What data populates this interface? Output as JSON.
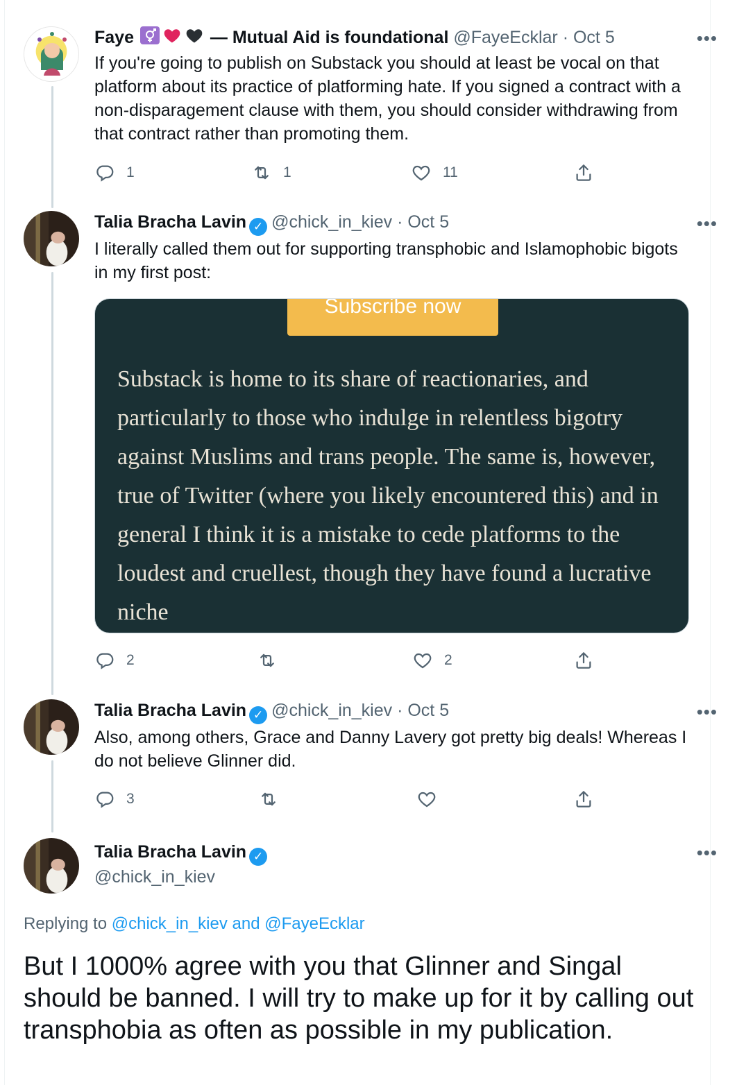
{
  "tweets": [
    {
      "name": "Faye",
      "display_suffix": "— Mutual Aid is foundational",
      "handle": "@FayeEcklar",
      "date": "· Oct 5",
      "more": "•••",
      "text": "If you're going to publish on Substack you should at least be vocal on that platform about its practice of platforming hate. If you signed a contract with a non-disparagement clause with them, you should consider withdrawing from that contract rather than promoting them.",
      "replies": "1",
      "retweets": "1",
      "likes": "11"
    },
    {
      "name": "Talia Bracha Lavin",
      "handle": "@chick_in_kiev",
      "date": "· Oct 5",
      "more": "•••",
      "text": "I literally called them out for supporting transphobic and Islamophobic bigots in my first post:",
      "card": {
        "button_label": "Subscribe now",
        "quote": "Substack is home to its share of reactionaries, and particularly to those who indulge in relentless bigotry against Muslims and trans people. The same is, however, true of Twitter (where you likely encountered this) and in general I think it is a mistake to cede platforms to the loudest and cruellest, though they have found a lucrative niche",
        "bg_color": "#1a3034",
        "button_color": "#f3bb4d"
      },
      "replies": "2",
      "retweets": "",
      "likes": "2"
    },
    {
      "name": "Talia Bracha Lavin",
      "handle": "@chick_in_kiev",
      "date": "· Oct 5",
      "more": "•••",
      "text": "Also, among others, Grace and Danny Lavery got pretty big deals! Whereas I do not believe Glinner did.",
      "replies": "3",
      "retweets": "",
      "likes": ""
    }
  ],
  "main_tweet": {
    "name": "Talia Bracha Lavin",
    "handle": "@chick_in_kiev",
    "more": "•••",
    "replying_prefix": "Replying to",
    "replying_handle_1": "@chick_in_kiev",
    "replying_and": "and",
    "replying_handle_2": "@FayeEcklar",
    "text": "But I 1000% agree with you that Glinner and Singal should be banned. I will try to make up for it by calling out transphobia as often as possible in my publication."
  },
  "icons": [
    "reply-icon",
    "retweet-icon",
    "like-icon",
    "share-icon",
    "verified-icon",
    "transgender-symbol-icon",
    "red-heart-icon",
    "black-heart-icon"
  ],
  "colors": {
    "link": "#1d9bf0",
    "secondary_text": "#536471",
    "verified": "#1d9bf0"
  }
}
